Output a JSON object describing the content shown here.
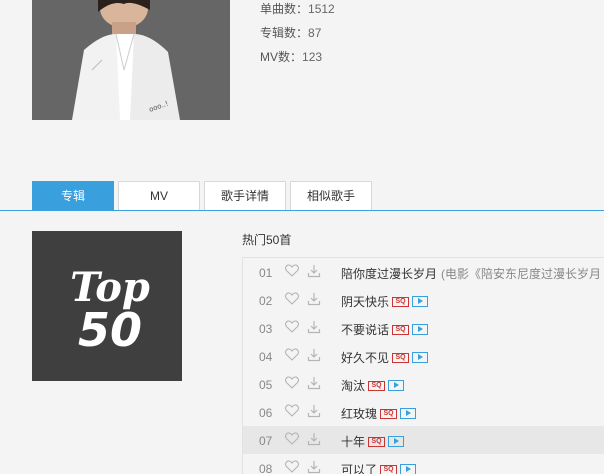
{
  "artist": {
    "stats": [
      {
        "label": "单曲数：",
        "value": "1512"
      },
      {
        "label": "专辑数：",
        "value": "87"
      },
      {
        "label": "MV数：",
        "value": "123"
      }
    ]
  },
  "tabs": [
    {
      "label": "专辑",
      "active": true
    },
    {
      "label": "MV",
      "active": false
    },
    {
      "label": "歌手详情",
      "active": false
    },
    {
      "label": "相似歌手",
      "active": false
    }
  ],
  "hot_section": {
    "title": "热门50首",
    "cover_text_line1": "Top",
    "cover_text_line2": "50"
  },
  "songs": [
    {
      "num": "01",
      "title": "陪你度过漫长岁月",
      "subtitle": "(电影《陪安东尼度过漫长岁月",
      "sq": false,
      "mv": false,
      "highlight": false
    },
    {
      "num": "02",
      "title": "阴天快乐",
      "subtitle": "",
      "sq": true,
      "mv": true,
      "highlight": false
    },
    {
      "num": "03",
      "title": "不要说话",
      "subtitle": "",
      "sq": true,
      "mv": true,
      "highlight": false
    },
    {
      "num": "04",
      "title": "好久不见",
      "subtitle": "",
      "sq": true,
      "mv": true,
      "highlight": false
    },
    {
      "num": "05",
      "title": "淘汰",
      "subtitle": "",
      "sq": true,
      "mv": true,
      "highlight": false
    },
    {
      "num": "06",
      "title": "红玫瑰",
      "subtitle": "",
      "sq": true,
      "mv": true,
      "highlight": false
    },
    {
      "num": "07",
      "title": "十年",
      "subtitle": "",
      "sq": true,
      "mv": true,
      "highlight": true
    },
    {
      "num": "08",
      "title": "可以了",
      "subtitle": "",
      "sq": true,
      "mv": true,
      "highlight": false
    }
  ],
  "badges": {
    "sq": "SQ"
  },
  "colors": {
    "accent": "#3a9fdd",
    "sq_red": "#cc3333"
  },
  "icons": {
    "like": "heart-icon",
    "download": "download-icon",
    "mv": "play-icon"
  }
}
